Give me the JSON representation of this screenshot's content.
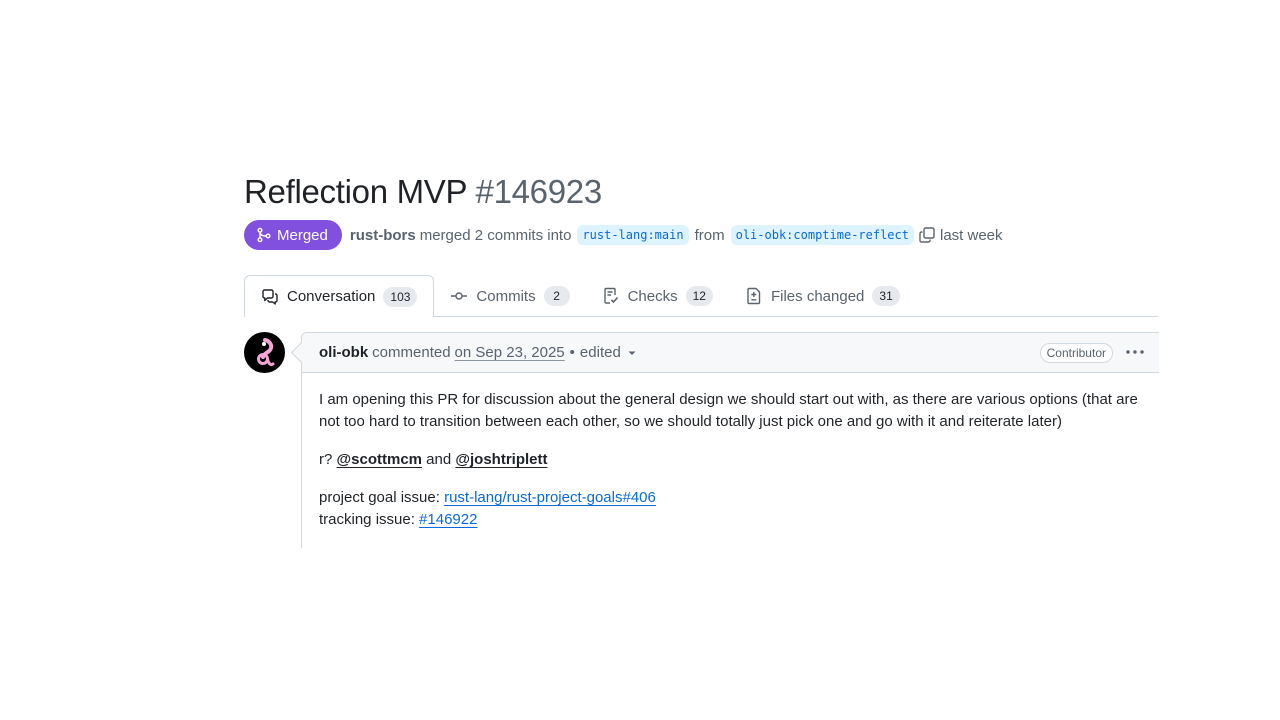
{
  "pr": {
    "title": "Reflection MVP",
    "number": "#146923"
  },
  "meta": {
    "state_label": "Merged",
    "state_color": "#8250df",
    "author": "rust-bors",
    "action_text": "merged 2 commits into",
    "base_branch": "rust-lang:main",
    "from_text": "from",
    "head_branch": "oli-obk:comptime-reflect",
    "time": "last week"
  },
  "tabs": [
    {
      "label": "Conversation",
      "count": "103",
      "icon": "conversation-icon",
      "selected": true
    },
    {
      "label": "Commits",
      "count": "2",
      "icon": "commit-icon",
      "selected": false
    },
    {
      "label": "Checks",
      "count": "12",
      "icon": "checklist-icon",
      "selected": false
    },
    {
      "label": "Files changed",
      "count": "31",
      "icon": "file-diff-icon",
      "selected": false
    }
  ],
  "comment": {
    "author": "oli-obk",
    "verb": "commented",
    "date": "on Sep 23, 2025",
    "dot": "•",
    "edited": "edited",
    "role_label": "Contributor",
    "body": {
      "paragraph1": "I am opening this PR for discussion about the general design we should start out with, as there are various options (that are not too hard to transition between each other, so we should totally just pick one and go with it and reiterate later)",
      "r_prefix": "r?",
      "mention1": "@scottmcm",
      "and_text": "and",
      "mention2": "@joshtriplett",
      "goal_label": "project goal issue:",
      "goal_link": "rust-lang/rust-project-goals#406",
      "tracking_label": "tracking issue:",
      "tracking_link": "#146922"
    }
  },
  "colors": {
    "link": "#0969da",
    "merged": "#8250df",
    "border": "#d1d9e0",
    "muted_text": "#59636e"
  }
}
